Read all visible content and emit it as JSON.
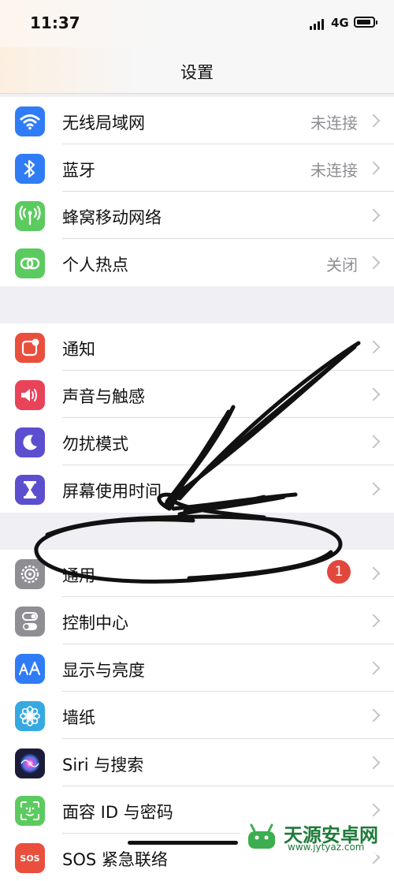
{
  "status": {
    "time": "11:37",
    "carrier": "4G"
  },
  "nav": {
    "title": "设置"
  },
  "group1": [
    {
      "label": "无线局域网",
      "value": "未连接",
      "icon": "wifi-icon",
      "color": "#2f7cf6"
    },
    {
      "label": "蓝牙",
      "value": "未连接",
      "icon": "bluetooth-icon",
      "color": "#2f7cf6"
    },
    {
      "label": "蜂窝移动网络",
      "value": "",
      "icon": "cellular-icon",
      "color": "#5ccb5f"
    },
    {
      "label": "个人热点",
      "value": "关闭",
      "icon": "hotspot-icon",
      "color": "#5ccb5f"
    }
  ],
  "group2": [
    {
      "label": "通知",
      "icon": "notification-icon",
      "color": "#ea4f3d"
    },
    {
      "label": "声音与触感",
      "icon": "sound-icon",
      "color": "#e9435a"
    },
    {
      "label": "勿扰模式",
      "icon": "moon-icon",
      "color": "#5b4fcf"
    },
    {
      "label": "屏幕使用时间",
      "icon": "hourglass-icon",
      "color": "#5b4fcf"
    }
  ],
  "group3": [
    {
      "label": "通用",
      "badge": "1",
      "icon": "gear-icon",
      "color": "#8e8e93"
    },
    {
      "label": "控制中心",
      "icon": "toggles-icon",
      "color": "#8e8e93"
    },
    {
      "label": "显示与亮度",
      "icon": "text-size-icon",
      "color": "#2f7cf6"
    },
    {
      "label": "墙纸",
      "icon": "flower-icon",
      "color": "#36a9e1"
    },
    {
      "label": "Siri 与搜索",
      "icon": "siri-icon",
      "color": "#1c1c3a"
    },
    {
      "label": "面容 ID 与密码",
      "icon": "face-id-icon",
      "color": "#5ccb5f"
    },
    {
      "label": "SOS 紧急联络",
      "icon": "sos-icon",
      "color": "#ea4f3d"
    }
  ],
  "watermark": {
    "text": "天源安卓网",
    "url": "www.jytyaz.com"
  }
}
